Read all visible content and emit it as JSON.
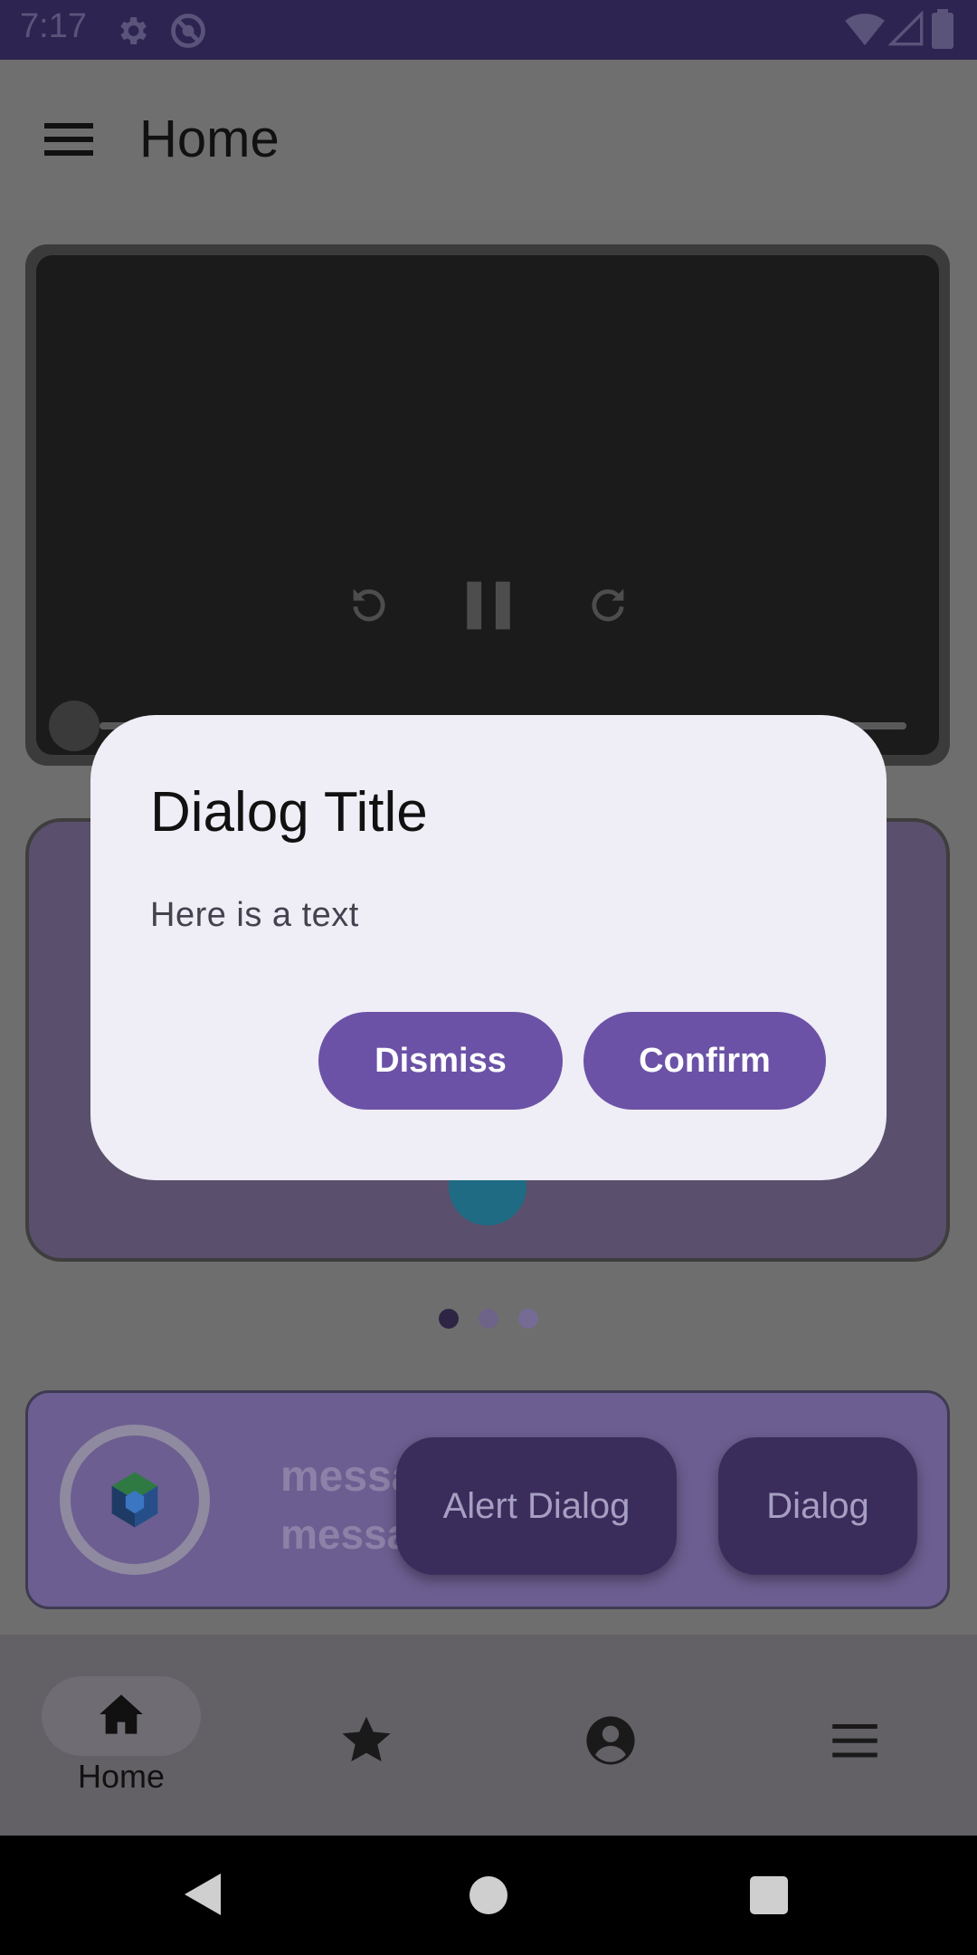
{
  "status_bar": {
    "time": "7:17"
  },
  "app_bar": {
    "title": "Home"
  },
  "video": {
    "state": "playing"
  },
  "pager": {
    "count": 3,
    "active_index": 0
  },
  "message_card": {
    "line1": "messa",
    "line2": "messa"
  },
  "buttons": {
    "alert_dialog": "Alert Dialog",
    "dialog": "Dialog"
  },
  "bottom_nav": {
    "items": [
      {
        "label": "Home",
        "icon": "home-icon"
      },
      {
        "icon": "star-icon"
      },
      {
        "icon": "account-icon"
      },
      {
        "icon": "menu-icon"
      }
    ]
  },
  "dialog": {
    "title": "Dialog Title",
    "text": "Here is a text",
    "dismiss_label": "Dismiss",
    "confirm_label": "Confirm"
  },
  "colors": {
    "accent": "#6b52a6",
    "dialog_bg": "#efedf6",
    "status_bar": "#2e2451"
  }
}
